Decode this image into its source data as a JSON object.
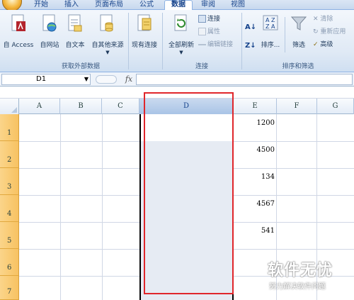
{
  "tabs": [
    "开始",
    "插入",
    "页面布局",
    "公式",
    "数据",
    "审阅",
    "视图"
  ],
  "active_tab": "数据",
  "ribbon": {
    "external_data": {
      "label": "获取外部数据",
      "buttons": [
        "自 Access",
        "自网站",
        "自文本",
        "自其他来源",
        "现有连接"
      ]
    },
    "connections": {
      "label": "连接",
      "refresh_all": "全部刷新",
      "items": [
        "连接",
        "属性",
        "编辑链接"
      ]
    },
    "sort_filter": {
      "label": "排序和筛选",
      "sort": "排序...",
      "filter": "筛选",
      "items": [
        "清除",
        "重新应用",
        "高级"
      ]
    }
  },
  "formula_bar": {
    "name_box": "D1",
    "fx": "fx",
    "formula": ""
  },
  "columns": [
    "A",
    "B",
    "C",
    "D",
    "E",
    "F",
    "G"
  ],
  "selected_column": "D",
  "rows": [
    "1",
    "2",
    "3",
    "4",
    "5",
    "6",
    "7"
  ],
  "column_e_values": [
    "1200",
    "4500",
    "134",
    "4567",
    "541",
    "",
    ""
  ],
  "watermark": {
    "title": "软件无忧",
    "subtitle": "努力解决软件问题"
  },
  "colors": {
    "highlight_box": "#e0262b",
    "row_header_selected": "#f7c262",
    "selected_column_fill": "#e6ebf3"
  }
}
